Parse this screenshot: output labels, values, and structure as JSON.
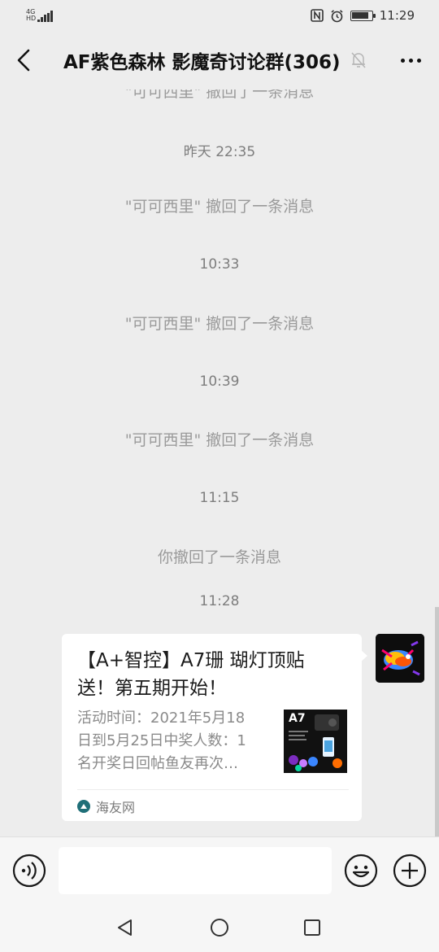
{
  "status_bar": {
    "network_label": "4G",
    "network_sub": "HD",
    "time": "11:29",
    "battery_level": 0.85
  },
  "header": {
    "title": "AF紫色森林 影魔奇讨论群(306)",
    "back_icon": "chevron-left-icon",
    "mute_icon": "bell-off-icon",
    "more_icon": "more-dots-icon"
  },
  "chat": {
    "clipped_notice": "\"可可西里\" 撤回了一条消息",
    "events": [
      {
        "kind": "time",
        "text": "昨天 22:35"
      },
      {
        "kind": "notice",
        "text": "\"可可西里\" 撤回了一条消息"
      },
      {
        "kind": "time",
        "text": "10:33"
      },
      {
        "kind": "notice",
        "text": "\"可可西里\" 撤回了一条消息"
      },
      {
        "kind": "time",
        "text": "10:39"
      },
      {
        "kind": "notice",
        "text": "\"可可西里\" 撤回了一条消息"
      },
      {
        "kind": "time",
        "text": "11:15"
      },
      {
        "kind": "notice",
        "text": "你撤回了一条消息"
      },
      {
        "kind": "time",
        "text": "11:28"
      }
    ],
    "message_card": {
      "title_line1": "【A+智控】A7珊 瑚灯顶贴",
      "title_line2": "送！第五期开始！",
      "desc_line1": "活动时间：2021年5月18",
      "desc_line2": "日到5月25日中奖人数：1",
      "desc_line3": "名开奖日回帖鱼友再次…",
      "thumb_label": "A7",
      "source": "海友网"
    }
  },
  "input_bar": {
    "voice_icon": "voice-icon",
    "input_value": "",
    "emoji_icon": "emoji-icon",
    "plus_icon": "plus-icon"
  },
  "nav": {
    "back_icon": "nav-back-icon",
    "home_icon": "nav-home-icon",
    "recent_icon": "nav-recent-icon"
  },
  "colors": {
    "background": "#ededed",
    "bubble": "#ffffff",
    "system_text": "#9a9a9a",
    "source_icon": "#1f6f78"
  }
}
